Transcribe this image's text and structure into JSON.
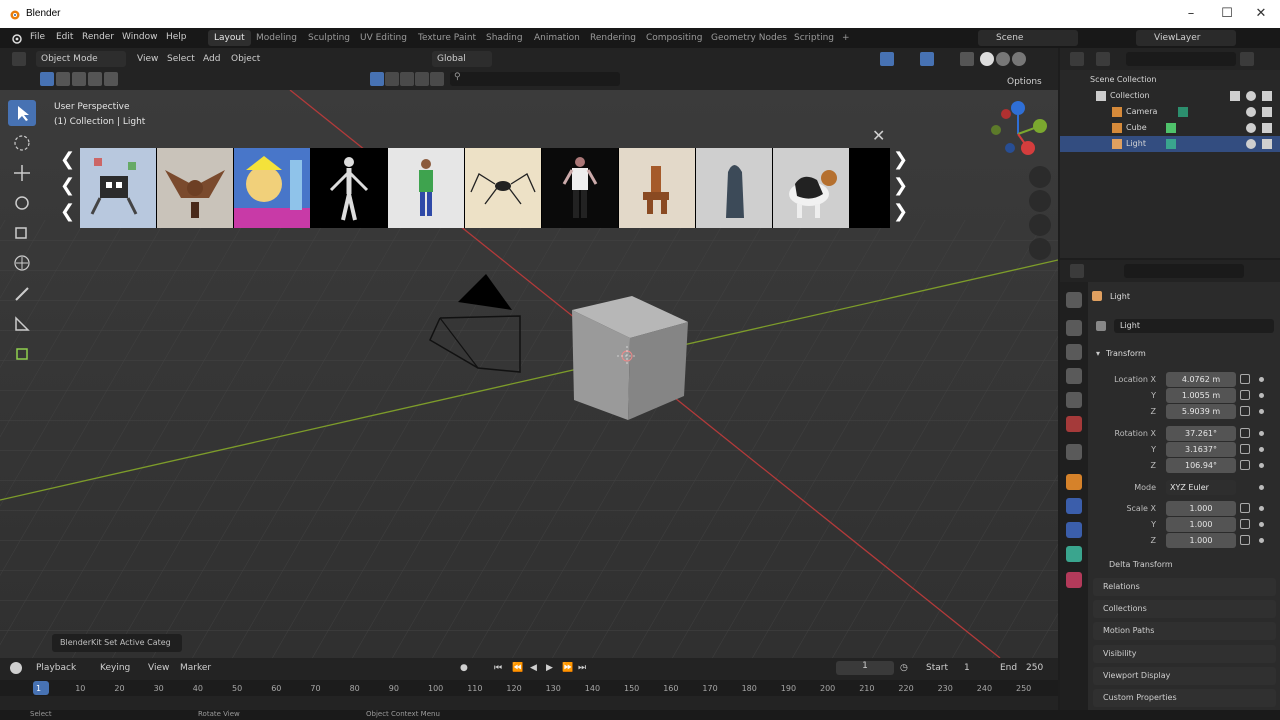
{
  "window": {
    "title": "Blender"
  },
  "menus": [
    "File",
    "Edit",
    "Render",
    "Window",
    "Help"
  ],
  "workspaces": [
    "Layout",
    "Modeling",
    "Sculpting",
    "UV Editing",
    "Texture Paint",
    "Shading",
    "Animation",
    "Rendering",
    "Compositing",
    "Geometry Nodes",
    "Scripting"
  ],
  "active_workspace": "Layout",
  "top_right": {
    "scene": "Scene",
    "view_layer": "ViewLayer"
  },
  "viewport_header": {
    "mode": "Object Mode",
    "menus": [
      "View",
      "Select",
      "Add",
      "Object"
    ],
    "orientation": "Global",
    "options": "Options"
  },
  "viewport_info": {
    "line1": "User Perspective",
    "line2": "(1) Collection | Light"
  },
  "asset_thumbnails": [
    "robot",
    "bat creature",
    "cartoon character",
    "mannequin",
    "man in green shirt",
    "spider",
    "man in white t-shirt",
    "wooden figure",
    "hooded figure",
    "collie dog"
  ],
  "status_popup": "BlenderKit Set Active Categ",
  "outliner": {
    "root": "Scene Collection",
    "items": [
      {
        "name": "Collection",
        "level": 1
      },
      {
        "name": "Camera",
        "level": 2
      },
      {
        "name": "Cube",
        "level": 2
      },
      {
        "name": "Light",
        "level": 2,
        "selected": true
      }
    ]
  },
  "properties": {
    "object_name": "Light",
    "data_name": "Light",
    "transform_title": "Transform",
    "location": {
      "label": "Location X",
      "x": "4.0762 m",
      "y": "1.0055 m",
      "z": "5.9039 m"
    },
    "rotation": {
      "label": "Rotation X",
      "x": "37.261°",
      "y": "3.1637°",
      "z": "106.94°"
    },
    "mode": {
      "label": "Mode",
      "value": "XYZ Euler"
    },
    "scale": {
      "label": "Scale X",
      "x": "1.000",
      "y": "1.000",
      "z": "1.000"
    },
    "axis_y": "Y",
    "axis_z": "Z",
    "panels": [
      "Delta Transform",
      "Relations",
      "Collections",
      "Motion Paths",
      "Visibility",
      "Viewport Display",
      "Custom Properties"
    ]
  },
  "timeline": {
    "menus": [
      "Playback",
      "Keying",
      "View",
      "Marker"
    ],
    "current_frame": "1",
    "start_label": "Start",
    "start": "1",
    "end_label": "End",
    "end": "250",
    "ticks": [
      "1",
      "10",
      "20",
      "30",
      "40",
      "50",
      "60",
      "70",
      "80",
      "90",
      "100",
      "110",
      "120",
      "130",
      "140",
      "150",
      "160",
      "170",
      "180",
      "190",
      "200",
      "210",
      "220",
      "230",
      "240",
      "250"
    ]
  },
  "statusbar": {
    "select": "Select",
    "rotate": "Rotate View",
    "context": "Object Context Menu"
  },
  "colors": {
    "accent": "#4772b3",
    "x_axis": "#b33a3a",
    "y_axis": "#7d9c2a",
    "selected_row": "#334d80"
  }
}
